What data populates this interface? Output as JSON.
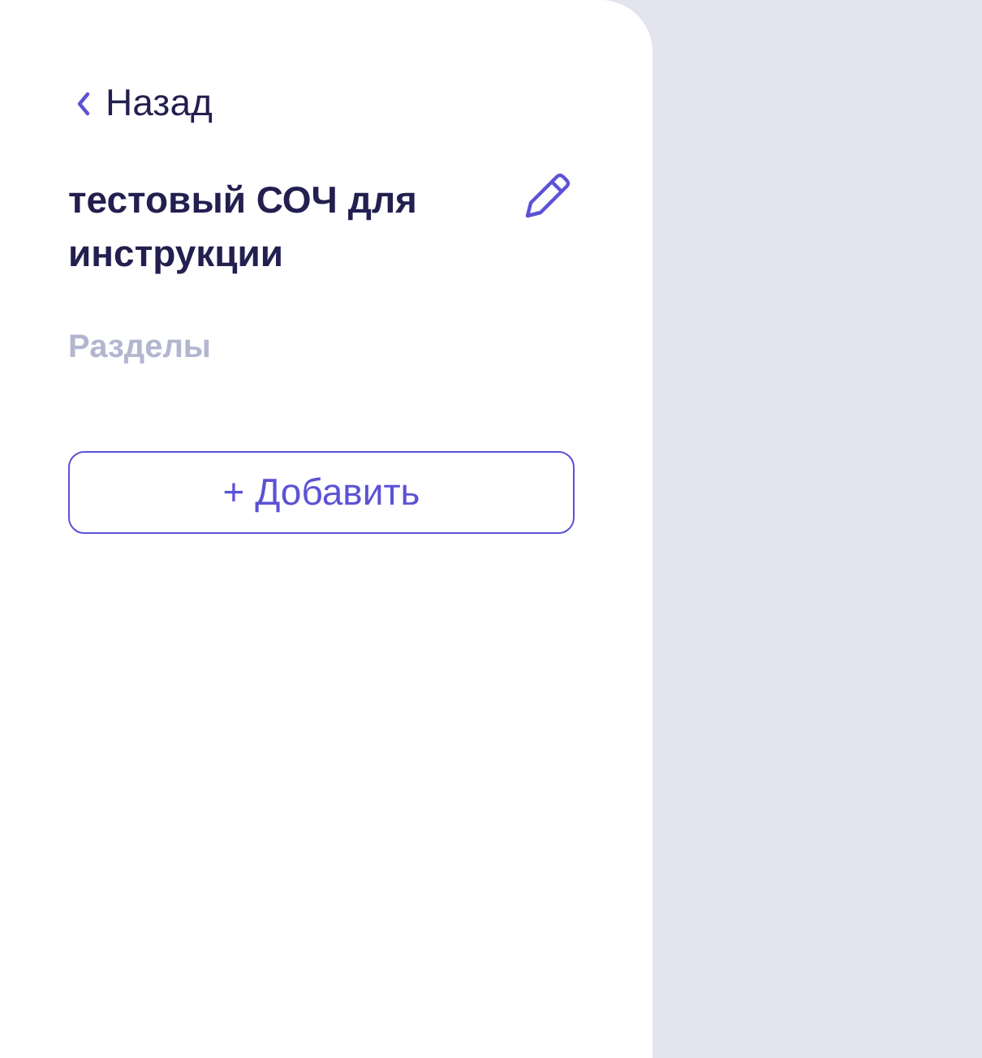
{
  "back_link": {
    "label": "Назад"
  },
  "title": "тестовый СОЧ для инструкции",
  "sections_label": "Разделы",
  "add_button": {
    "label": "+ Добавить"
  }
}
